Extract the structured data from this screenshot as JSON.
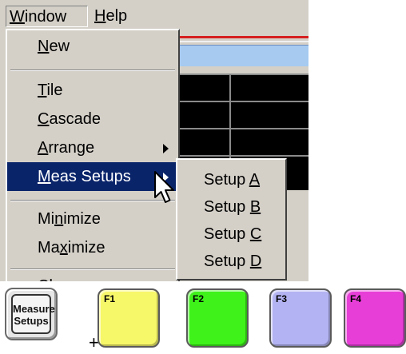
{
  "menubar": {
    "window_label": "Window",
    "window_accel": "W",
    "window_rest": "indow",
    "help_label": "Help",
    "help_accel": "H",
    "help_rest": "elp"
  },
  "window_menu": {
    "items": [
      {
        "accel": "N",
        "rest": "ew",
        "before": ""
      },
      {
        "accel": "T",
        "rest": "ile",
        "before": ""
      },
      {
        "accel": "C",
        "rest": "ascade",
        "before": ""
      },
      {
        "accel": "A",
        "rest": "rrange",
        "before": ""
      },
      {
        "accel": "M",
        "rest": "eas Setups",
        "before": ""
      },
      {
        "before": "Mi",
        "accel": "n",
        "rest": "imize"
      },
      {
        "before": "Ma",
        "accel": "x",
        "rest": "imize"
      },
      {
        "before": "",
        "accel": "",
        "rest": "Cl"
      }
    ]
  },
  "meas_setups_submenu": {
    "items": [
      {
        "prefix": "Setup ",
        "accel": "A"
      },
      {
        "prefix": "Setup ",
        "accel": "B"
      },
      {
        "prefix": "Setup ",
        "accel": "C"
      },
      {
        "prefix": "Setup ",
        "accel": "D"
      }
    ]
  },
  "keys": {
    "measure_setups_line1": "Measure",
    "measure_setups_line2": "Setups",
    "plus": "+",
    "f1": "F1",
    "f2": "F2",
    "f3": "F3",
    "f4": "F4"
  },
  "colors": {
    "menu_bg": "#d4d0c8",
    "highlight": "#0a246a",
    "f1": "#f7f76a",
    "f2": "#3ef21a",
    "f3": "#b3b3f3",
    "f4": "#e83ed8"
  }
}
